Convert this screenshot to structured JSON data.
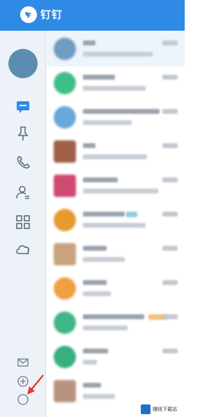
{
  "app": {
    "title": "钉钉",
    "accent_color": "#2f8ae5"
  },
  "rail": {
    "items": [
      {
        "name": "chat-icon",
        "active": true
      },
      {
        "name": "pin-icon",
        "active": false
      },
      {
        "name": "phone-icon",
        "active": false
      },
      {
        "name": "contacts-icon",
        "active": false
      },
      {
        "name": "workbench-grid-icon",
        "active": false
      },
      {
        "name": "cloud-drive-icon",
        "active": false
      }
    ],
    "bottom_items": [
      "mail-icon",
      "add-icon",
      "settings-circle-icon"
    ]
  },
  "chat_list": {
    "rows": [
      {
        "avatar_color": "#6f9cc0",
        "selected": true
      },
      {
        "avatar_color": "#3fbf88",
        "selected": false
      },
      {
        "avatar_color": "#68a7d8",
        "selected": false
      },
      {
        "avatar_color": "#a0604a",
        "selected": false
      },
      {
        "avatar_color": "#d04a70",
        "selected": false
      },
      {
        "avatar_color": "#e69a30",
        "selected": false
      },
      {
        "avatar_color": "#c9a27e",
        "selected": false
      },
      {
        "avatar_color": "#f0a040",
        "selected": false
      },
      {
        "avatar_color": "#40b585",
        "selected": false
      },
      {
        "avatar_color": "#38b07e",
        "selected": false
      },
      {
        "avatar_color": "#b89480",
        "selected": false
      }
    ]
  },
  "watermark": {
    "text": "赚钱下载站"
  },
  "annotation": {
    "arrow_color": "#e53935"
  }
}
